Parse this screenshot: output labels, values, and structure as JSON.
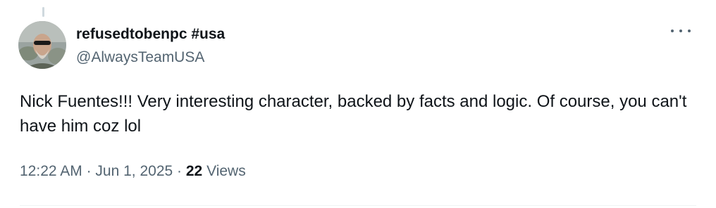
{
  "tweet": {
    "author": {
      "display_name": "refusedtobenpc #usa",
      "handle": "@AlwaysTeamUSA",
      "avatar_icon": "user-avatar-photo"
    },
    "text": "Nick Fuentes!!! Very interesting character, backed by facts and logic. Of course, you can't have him coz lol",
    "timestamp": {
      "time": "12:22 AM",
      "separator": "·",
      "date": "Jun 1, 2025"
    },
    "views": {
      "separator": "·",
      "count": "22",
      "label": "Views"
    },
    "more_icon": "more-horizontal-icon"
  },
  "colors": {
    "primary_text": "#0f1419",
    "secondary_text": "#536471",
    "divider": "#eff3f4",
    "thread_line": "#cfd9de"
  }
}
